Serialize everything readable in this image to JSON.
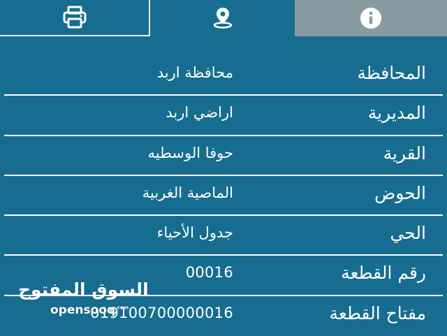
{
  "tabs": [
    {
      "icon": "printer-icon"
    },
    {
      "icon": "location-pin-icon"
    },
    {
      "icon": "info-icon",
      "selected": true
    }
  ],
  "colors": {
    "background": "#176d8f",
    "active_tab": "#8a9aa3",
    "text": "#ffffff",
    "divider": "#ffffff"
  },
  "fields": [
    {
      "label": "المحافظة",
      "value": "محافظة اربد"
    },
    {
      "label": "المديرية",
      "value": "اراضي اربد"
    },
    {
      "label": "القرية",
      "value": "حوفا الوسطيه"
    },
    {
      "label": "الحوض",
      "value": "الماصية الغربية"
    },
    {
      "label": "الحي",
      "value": "جدول الأحياء"
    },
    {
      "label": "رقم القطعة",
      "value": "00016"
    },
    {
      "label": "مفتاح القطعة",
      "value": "019100700000016"
    }
  ],
  "watermark": {
    "arabic": "السوق المفتوح",
    "latin": "opensooq",
    "suffix": ".com"
  }
}
